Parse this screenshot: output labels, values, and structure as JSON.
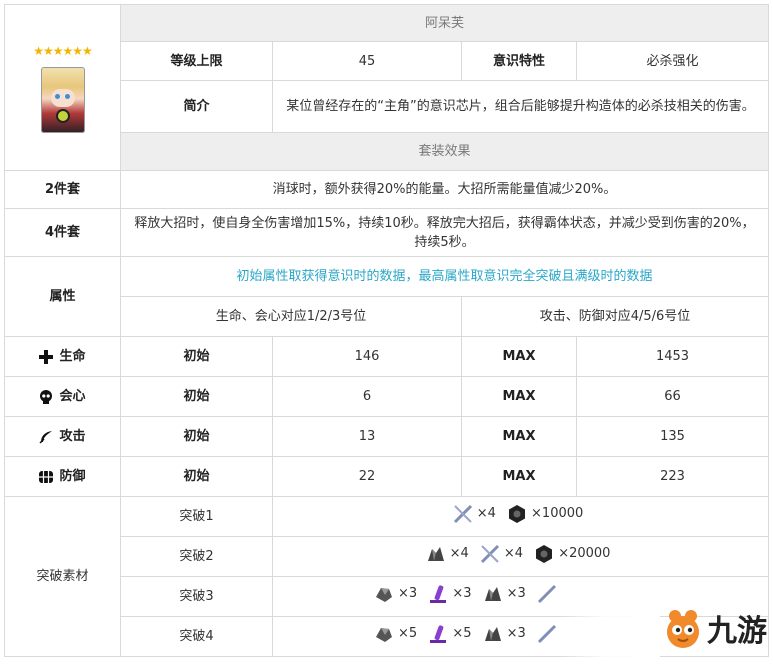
{
  "card": {
    "stars": "★★★★★★",
    "name": "阿呆芙",
    "level_cap_label": "等级上限",
    "level_cap_value": "45",
    "trait_label": "意识特性",
    "trait_value": "必杀强化",
    "intro_label": "简介",
    "intro_text": "某位曾经存在的“主角”的意识芯片，组合后能够提升构造体的必杀技相关的伤害。"
  },
  "set": {
    "header": "套装效果",
    "two_label": "2件套",
    "two_text": "消球时，额外获得20%的能量。大招所需能量值减少20%。",
    "four_label": "4件套",
    "four_text": "释放大招时，使自身全伤害增加15%，持续10秒。释放完大招后，获得霸体状态，并减少受到伤害的20%，持续5秒。"
  },
  "attributes": {
    "label": "属性",
    "note": "初始属性取获得意识时的数据，最高属性取意识完全突破且满级时的数据",
    "left_slots": "生命、会心对应1/2/3号位",
    "right_slots": "攻击、防御对应4/5/6号位",
    "init_label": "初始",
    "max_label": "MAX",
    "rows": [
      {
        "name": "生命",
        "icon": "plus-icon",
        "init": "146",
        "max": "1453"
      },
      {
        "name": "会心",
        "icon": "skull-icon",
        "init": "6",
        "max": "66"
      },
      {
        "name": "攻击",
        "icon": "feather-icon",
        "init": "13",
        "max": "135"
      },
      {
        "name": "防御",
        "icon": "shield-grid-icon",
        "init": "22",
        "max": "223"
      }
    ]
  },
  "breakthrough": {
    "label": "突破素材",
    "rows": [
      {
        "name": "突破1",
        "q": [
          "×4",
          "×10000"
        ]
      },
      {
        "name": "突破2",
        "q": [
          "×4",
          "×4",
          "×20000"
        ]
      },
      {
        "name": "突破3",
        "q": [
          "×3",
          "×3",
          "×3"
        ]
      },
      {
        "name": "突破4",
        "q": [
          "×5",
          "×5",
          "×3"
        ]
      }
    ]
  },
  "watermark": {
    "text": "九游"
  }
}
